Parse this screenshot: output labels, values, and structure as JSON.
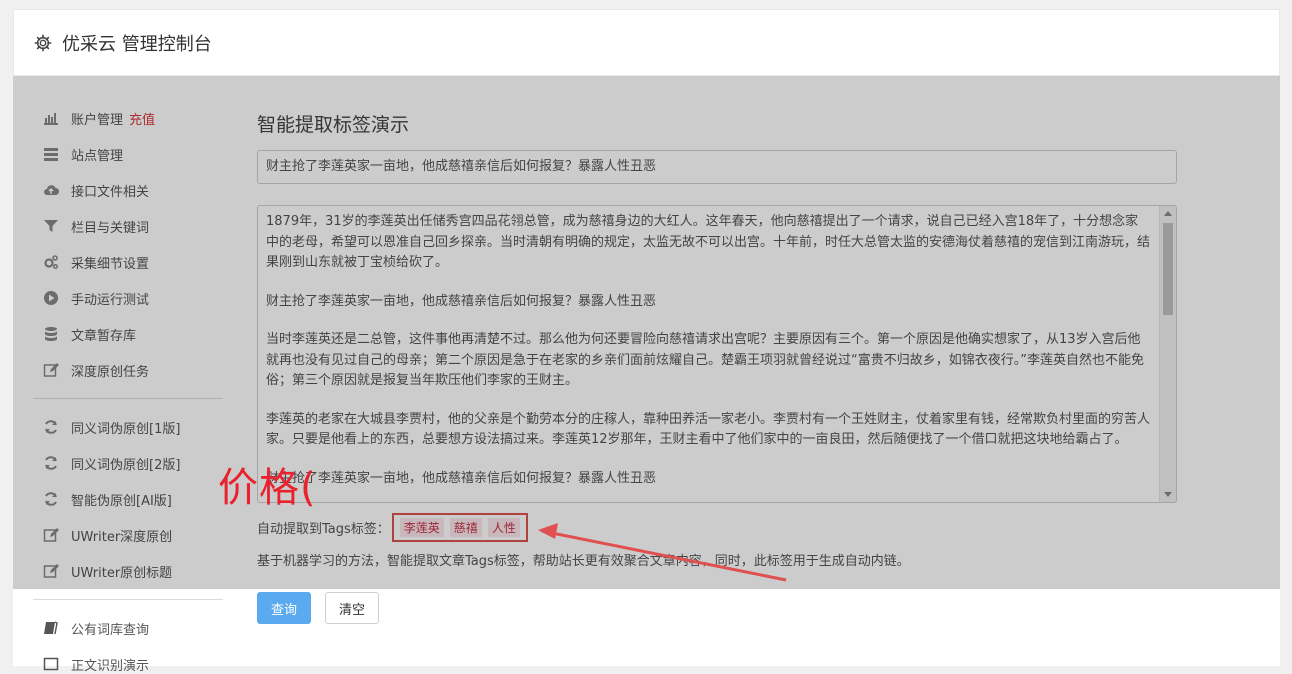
{
  "header": {
    "title": "优采云 管理控制台"
  },
  "sidebar": {
    "items": [
      {
        "label": "账户管理",
        "extra": "充值",
        "icon": "bar-chart-icon"
      },
      {
        "label": "站点管理",
        "icon": "list-icon"
      },
      {
        "label": "接口文件相关",
        "icon": "cloud-upload-icon"
      },
      {
        "label": "栏目与关键词",
        "icon": "filter-icon"
      },
      {
        "label": "采集细节设置",
        "icon": "cogs-icon"
      },
      {
        "label": "手动运行测试",
        "icon": "play-circle-icon"
      },
      {
        "label": "文章暂存库",
        "icon": "database-icon"
      },
      {
        "label": "深度原创任务",
        "icon": "edit-icon"
      },
      {
        "label": "同义词伪原创[1版]",
        "icon": "refresh-icon"
      },
      {
        "label": "同义词伪原创[2版]",
        "icon": "refresh-icon"
      },
      {
        "label": "智能伪原创[AI版]",
        "icon": "refresh-icon"
      },
      {
        "label": "UWriter深度原创",
        "icon": "edit-icon"
      },
      {
        "label": "UWriter原创标题",
        "icon": "edit-icon"
      },
      {
        "label": "公有词库查询",
        "icon": "book-icon"
      },
      {
        "label": "正文识别演示",
        "icon": "window-icon"
      }
    ]
  },
  "main": {
    "page_title": "智能提取标签演示",
    "title_value": "财主抢了李莲英家一亩地，他成慈禧亲信后如何报复？暴露人性丑恶",
    "article": {
      "p1": "1879年，31岁的李莲英出任储秀宫四品花翎总管，成为慈禧身边的大红人。这年春天，他向慈禧提出了一个请求，说自己已经入宫18年了，十分想念家中的老母，希望可以恩准自己回乡探亲。当时清朝有明确的规定，太监无故不可以出宫。十年前，时任大总管太监的安德海仗着慈禧的宠信到江南游玩，结果刚到山东就被丁宝桢给砍了。",
      "p2": "财主抢了李莲英家一亩地，他成慈禧亲信后如何报复？暴露人性丑恶",
      "p3": "当时李莲英还是二总管，这件事他再清楚不过。那么他为何还要冒险向慈禧请求出宫呢？主要原因有三个。第一个原因是他确实想家了，从13岁入宫后他就再也没有见过自己的母亲；第二个原因是急于在老家的乡亲们面前炫耀自己。楚霸王项羽就曾经说过“富贵不归故乡，如锦衣夜行。”李莲英自然也不能免俗；第三个原因就是报复当年欺压他们李家的王财主。",
      "p4": "李莲英的老家在大城县李贾村，他的父亲是个勤劳本分的庄稼人，靠种田养活一家老小。李贾村有一个王姓财主，仗着家里有钱，经常欺负村里面的穷苦人家。只要是他看上的东西，总要想方设法搞过来。李莲英12岁那年，王财主看中了他们家中的一亩良田，然后随便找了一个借口就把这块地给霸占了。",
      "p5": "财主抢了李莲英家一亩地，他成慈禧亲信后如何报复？暴露人性丑恶"
    },
    "tags_label": "自动提取到Tags标签：",
    "tags": [
      "李莲英",
      "慈禧",
      "人性"
    ],
    "description": "基于机器学习的方法，智能提取文章Tags标签，帮助站长更有效聚合文章内容，同时，此标签用于生成自动内链。",
    "query_button": "查询",
    "clear_button": "清空"
  },
  "annotation": {
    "text": "价格(",
    "color": "#e8232f"
  }
}
